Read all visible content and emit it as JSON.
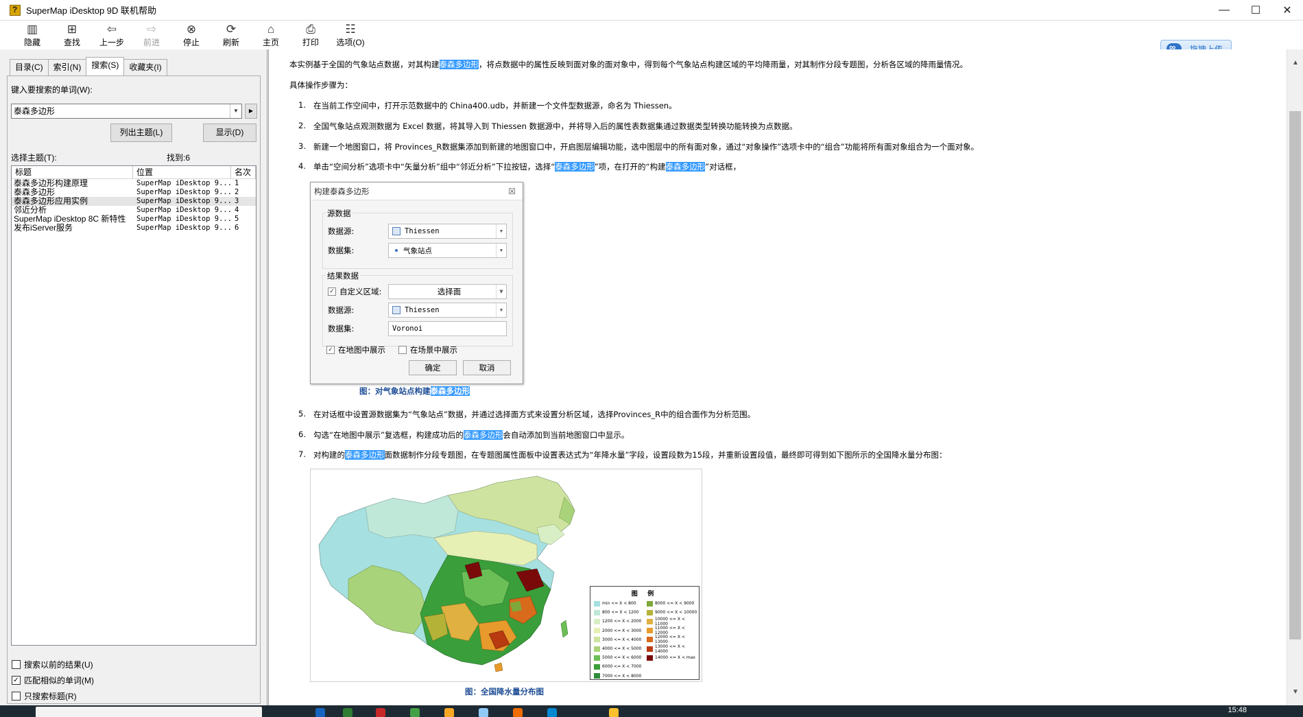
{
  "window": {
    "title": "SuperMap iDesktop 9D 联机帮助",
    "controls": [
      "—",
      "☐",
      "✕"
    ]
  },
  "toolbar": {
    "buttons": [
      {
        "label": "隐藏",
        "icon": "hide-icon",
        "enabled": true
      },
      {
        "label": "查找",
        "icon": "find-icon",
        "enabled": true
      },
      {
        "label": "上一步",
        "icon": "back-arrow-icon",
        "enabled": true
      },
      {
        "label": "前进",
        "icon": "forward-arrow-icon",
        "enabled": false
      },
      {
        "label": "停止",
        "icon": "stop-icon",
        "enabled": true
      },
      {
        "label": "刷新",
        "icon": "refresh-icon",
        "enabled": true
      },
      {
        "label": "主页",
        "icon": "home-icon",
        "enabled": true
      },
      {
        "label": "打印",
        "icon": "print-icon",
        "enabled": true
      },
      {
        "label": "选项(O)",
        "icon": "options-icon",
        "enabled": true
      }
    ],
    "upload_label": "拖拽上传"
  },
  "left": {
    "tabs": [
      "目录(C)",
      "索引(N)",
      "搜索(S)",
      "收藏夹(I)"
    ],
    "active_tab": 2,
    "keyword_label": "键入要搜索的单词(W):",
    "keyword_value": "泰森多边形",
    "list_topics_button": "列出主题(L)",
    "display_button": "显示(D)",
    "select_topic_label": "选择主题(T):",
    "found_label": "找到:6",
    "columns": [
      "标题",
      "位置",
      "名次"
    ],
    "results": [
      {
        "title": "泰森多边形构建原理",
        "location": "SuperMap iDesktop 9...",
        "rank": "1"
      },
      {
        "title": "泰森多边形",
        "location": "SuperMap iDesktop 9...",
        "rank": "2"
      },
      {
        "title": "泰森多边形应用实例",
        "location": "SuperMap iDesktop 9...",
        "rank": "3"
      },
      {
        "title": "邻近分析",
        "location": "SuperMap iDesktop 9...",
        "rank": "4"
      },
      {
        "title": "SuperMap iDesktop 8C 新特性",
        "location": "SuperMap iDesktop 9...",
        "rank": "5"
      },
      {
        "title": "发布iServer服务",
        "location": "SuperMap iDesktop 9...",
        "rank": "6"
      }
    ],
    "selected_row": 2,
    "options": [
      {
        "label": "搜索以前的结果(U)",
        "checked": false
      },
      {
        "label": "匹配相似的单词(M)",
        "checked": true
      },
      {
        "label": "只搜索标题(R)",
        "checked": false
      }
    ]
  },
  "content": {
    "intro_a": "本实例基于全国的气象站点数据，对其构建",
    "intro_hl": "泰森多边形",
    "intro_b": "，将点数据中的属性反映到面对象的面对象中，得到每个气象站点构建区域的平均降雨量，对其制作分段专题图，分析各区域的降雨量情况。",
    "steps_heading": "具体操作步骤为：",
    "step1": "在当前工作空间中，打开示范数据中的 China400.udb，并新建一个文件型数据源，命名为 Thiessen。",
    "step2": "全国气象站点观测数据为 Excel 数据，将其导入到 Thiessen 数据源中，并将导入后的属性表数据集通过数据类型转换功能转换为点数据。",
    "step3": "新建一个地图窗口，将 Provinces_R数据集添加到新建的地图窗口中，开启图层编辑功能，选中图层中的所有面对象，通过“对象操作”选项卡中的“组合”功能将所有面对象组合为一个面对象。",
    "step4_a": "单击“空间分析”选项卡中“矢量分析”组中“邻近分析”下拉按钮，选择“",
    "step4_hl1": "泰森多边形",
    "step4_b": "”项，在打开的“构建",
    "step4_hl2": "泰森多边形",
    "step4_c": "”对话框，",
    "step5": "在对话框中设置源数据集为“气象站点”数据，并通过选择面方式来设置分析区域，选择Provinces_R中的组合面作为分析范围。",
    "step6_a": "勾选“在地图中展示”复选框，构建成功后的",
    "step6_hl": "泰森多边形",
    "step6_b": "会自动添加到当前地图窗口中显示。",
    "step7_a": "对构建的",
    "step7_hl": "泰森多边形",
    "step7_b": "面数据制作分段专题图，在专题图属性面板中设置表达式为“年降水量”字段，设置段数为15段，并重新设置段值，最终即可得到如下图所示的全国降水量分布图：",
    "step_numbers": [
      "1.",
      "2.",
      "3.",
      "4.",
      "5.",
      "6.",
      "7."
    ],
    "caption1_a": "图：对气象站点构建",
    "caption1_hl": "泰森多边形",
    "caption2": "图：全国降水量分布图"
  },
  "dialog": {
    "title": "构建泰森多边形",
    "source_group": "源数据",
    "datasource_label": "数据源:",
    "datasource_value": "Thiessen",
    "dataset_label": "数据集:",
    "dataset_value": "气象站点",
    "result_group": "结果数据",
    "custom_region_label": "自定义区域:",
    "select_region_button": "选择面",
    "result_datasource_value": "Thiessen",
    "result_dataset_value": "Voronoi",
    "show_in_map": "在地图中展示",
    "show_in_scene": "在场景中展示",
    "ok": "确定",
    "cancel": "取消"
  },
  "map_legend": {
    "title": "图 例",
    "items": [
      {
        "label": "min <= X < 800",
        "color": "#a6e0e0"
      },
      {
        "label": "800 <= X < 1200",
        "color": "#bfe8d8"
      },
      {
        "label": "1200 <= X < 2000",
        "color": "#d8efc5"
      },
      {
        "label": "2000 <= X < 3000",
        "color": "#e6f0b5"
      },
      {
        "label": "3000 <= X < 4000",
        "color": "#cfe3a0"
      },
      {
        "label": "4000 <= X < 5000",
        "color": "#a9d37a"
      },
      {
        "label": "5000 <= X < 6000",
        "color": "#6cbf56"
      },
      {
        "label": "6000 <= X < 7000",
        "color": "#3a9e3a"
      },
      {
        "label": "7000 <= X < 8000",
        "color": "#2e8b3c"
      },
      {
        "label": "8000 <= X < 9000",
        "color": "#7fa83a"
      },
      {
        "label": "9000 <= X < 10000",
        "color": "#b5b238"
      },
      {
        "label": "10000 <= X < 11000",
        "color": "#e0b040"
      },
      {
        "label": "11000 <= X < 12000",
        "color": "#e89a2c"
      },
      {
        "label": "12000 <= X < 13000",
        "color": "#d86a1c"
      },
      {
        "label": "13000 <= X < 14000",
        "color": "#b83a10"
      },
      {
        "label": "14000 <= X < max",
        "color": "#7a0a0a"
      }
    ]
  },
  "taskbar": {
    "clock": "15:48"
  }
}
